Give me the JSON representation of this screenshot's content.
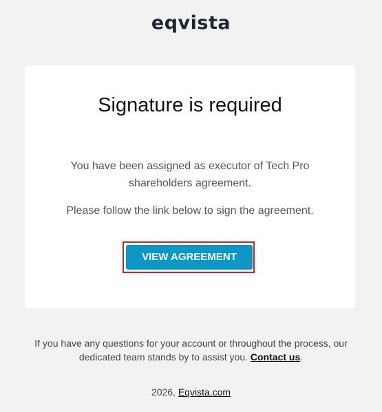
{
  "brand": {
    "logo_text": "eqvista"
  },
  "card": {
    "title": "Signature is required",
    "message_line_1": "You have been assigned as executor of Tech Pro shareholders agreement.",
    "message_line_2": "Please follow the link below to sign the agreement.",
    "button_label": "VIEW AGREEMENT",
    "button_color": "#0b98c4",
    "highlight_color": "#d0202a"
  },
  "footer": {
    "help_text": "If you have any questions for your account or throughout the process, our dedicated team stands by to assist you.",
    "contact_link": "Contact us",
    "trailing": ".",
    "year": "2026,",
    "site_link": "Eqvista.com"
  }
}
